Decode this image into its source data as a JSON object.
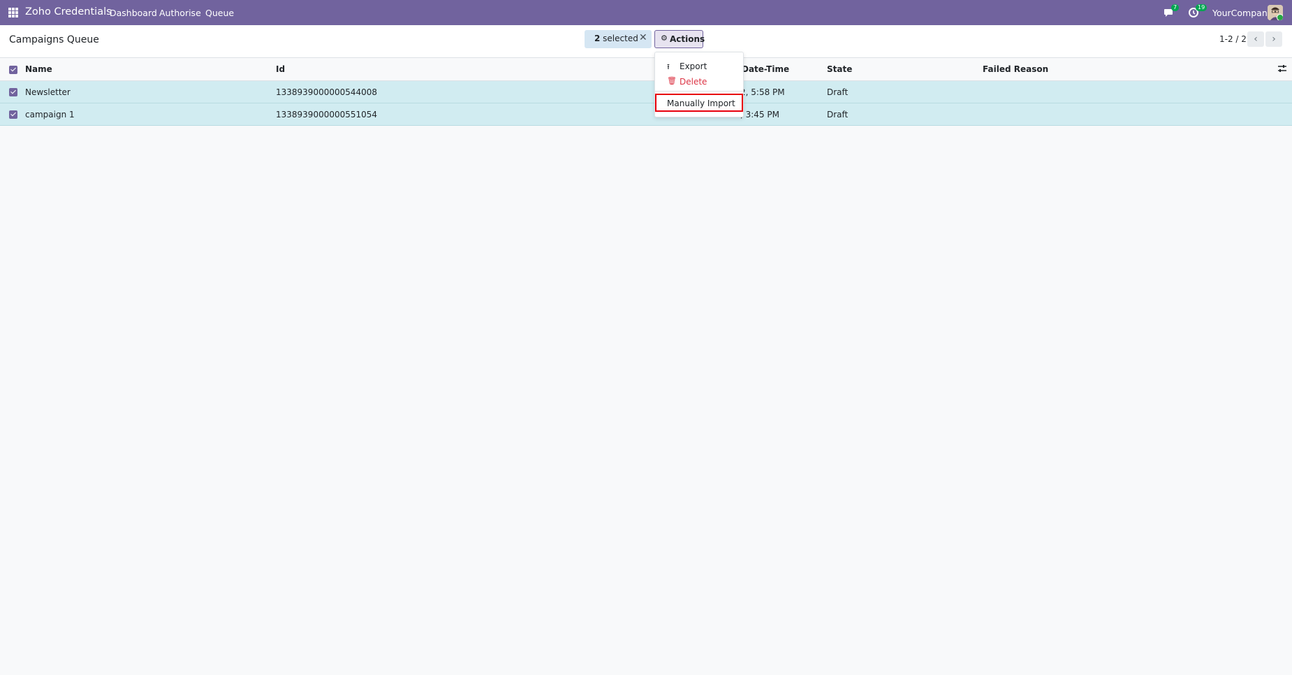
{
  "navbar": {
    "app_name": "Zoho Credentials",
    "menu": [
      "Dashboard",
      "Authorise",
      "Queue"
    ],
    "messages_count": "7",
    "activities_count": "19",
    "company": "YourCompany"
  },
  "control_panel": {
    "title": "Campaigns Queue",
    "selected_count": "2",
    "selected_suffix": " selected",
    "actions_label": "Actions",
    "pager": "1-2 / 2"
  },
  "table": {
    "columns": [
      "Name",
      "Id",
      "Date-Time",
      "State",
      "Failed Reason"
    ],
    "rows": [
      {
        "name": "Newsletter",
        "id": "1338939000000544008",
        "datetime": "2, 5:58 PM",
        "state": "Draft",
        "failed_reason": ""
      },
      {
        "name": "campaign 1",
        "id": "1338939000000551054",
        "datetime": ", 3:45 PM",
        "state": "Draft",
        "failed_reason": ""
      }
    ]
  },
  "actions_menu": {
    "items": [
      "Export",
      "Delete"
    ],
    "highlighted": "Manually Import"
  },
  "colors": {
    "brand": "#71639e",
    "selected_row": "#d1ecf1",
    "delete": "#dc3545",
    "highlight_border": "#e8000b"
  }
}
